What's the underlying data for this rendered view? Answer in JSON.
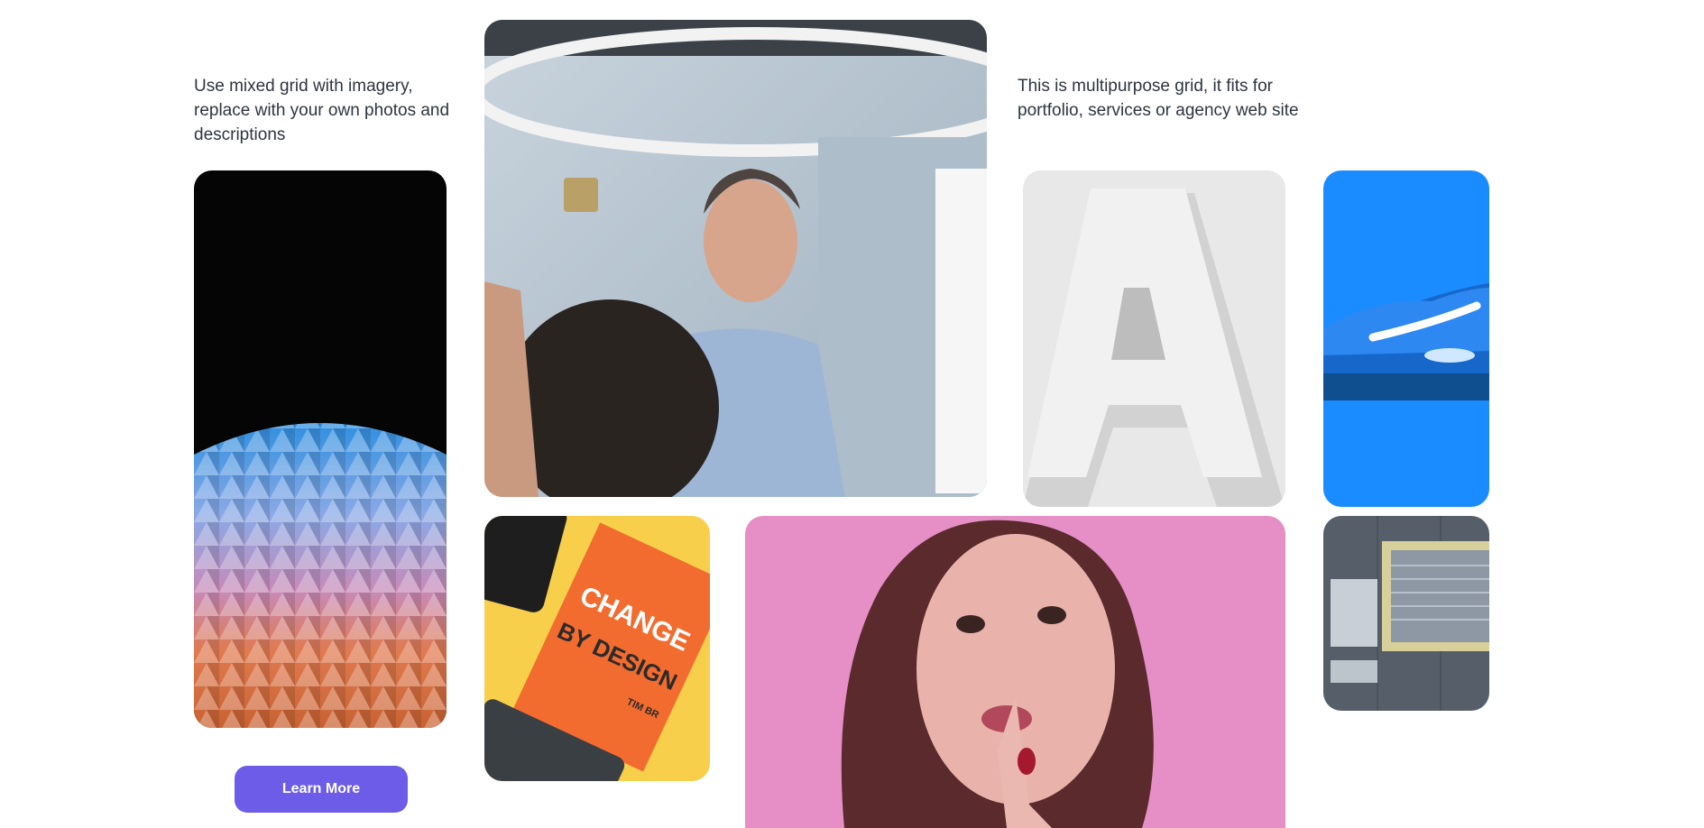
{
  "intro": {
    "left_text": "Use mixed grid with imagery, replace with your own photos and descriptions",
    "right_text": "This is multipurpose grid, it fits for portfolio, services or agency web site"
  },
  "cta": {
    "learn_more_label": "Learn More"
  },
  "book": {
    "title_line1": "CHANGE",
    "title_line2": "BY DESIGN",
    "author": "TIM BR"
  },
  "letter_tile": {
    "letter": "A"
  },
  "colors": {
    "accent": "#6c5ce7",
    "shoe_bg": "#1a8cff",
    "woman_bg": "#e58fc6",
    "book_bg": "#f7cf4b",
    "book_cover": "#f26b2f"
  }
}
